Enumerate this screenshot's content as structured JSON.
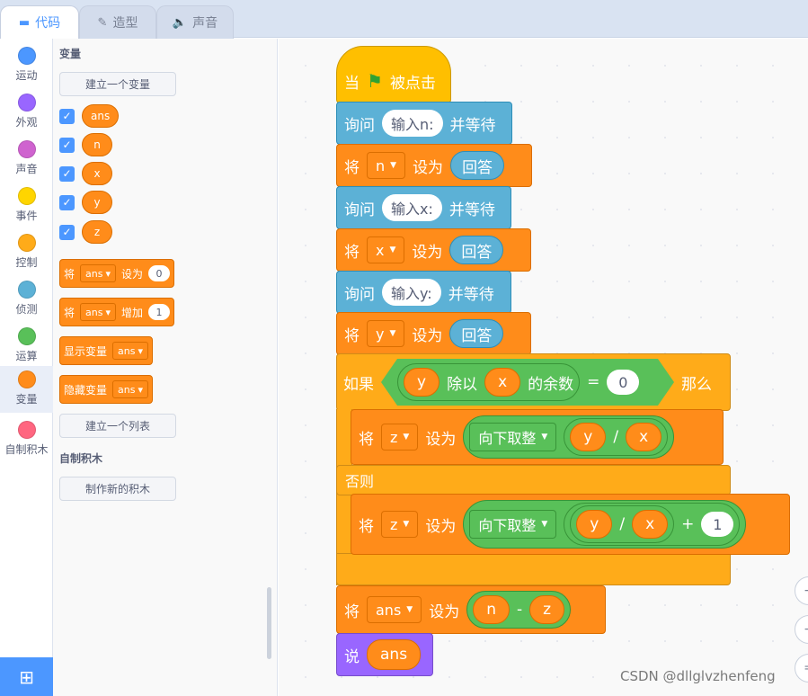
{
  "tabs": [
    {
      "label": "代码",
      "icon": "code-icon"
    },
    {
      "label": "造型",
      "icon": "brush-icon"
    },
    {
      "label": "声音",
      "icon": "speaker-icon"
    }
  ],
  "categories": [
    {
      "label": "运动",
      "color": "#4c97ff"
    },
    {
      "label": "外观",
      "color": "#9966ff"
    },
    {
      "label": "声音",
      "color": "#cf63cf"
    },
    {
      "label": "事件",
      "color": "#ffd500"
    },
    {
      "label": "控制",
      "color": "#ffab19"
    },
    {
      "label": "侦测",
      "color": "#5cb1d6"
    },
    {
      "label": "运算",
      "color": "#59c059"
    },
    {
      "label": "变量",
      "color": "#ff8c1a"
    },
    {
      "label": "自制积木",
      "color": "#ff6680"
    }
  ],
  "palette": {
    "section_variables": "变量",
    "make_variable": "建立一个变量",
    "variables": [
      "ans",
      "n",
      "x",
      "y",
      "z"
    ],
    "set_block": {
      "verb": "将",
      "var": "ans",
      "action": "设为",
      "value": "0"
    },
    "change_block": {
      "verb": "将",
      "var": "ans",
      "action": "增加",
      "value": "1"
    },
    "show_block": {
      "label": "显示变量",
      "var": "ans"
    },
    "hide_block": {
      "label": "隐藏变量",
      "var": "ans"
    },
    "make_list": "建立一个列表",
    "section_my_blocks": "自制积木",
    "make_block": "制作新的积木"
  },
  "script": {
    "hat": {
      "when": "当",
      "clicked": "被点击"
    },
    "ask_n": {
      "ask": "询问",
      "prompt": "输入n:",
      "wait": "并等待"
    },
    "set_n": {
      "verb": "将",
      "var": "n",
      "action": "设为",
      "value": "回答"
    },
    "ask_x": {
      "ask": "询问",
      "prompt": "输入x:",
      "wait": "并等待"
    },
    "set_x": {
      "verb": "将",
      "var": "x",
      "action": "设为",
      "value": "回答"
    },
    "ask_y": {
      "ask": "询问",
      "prompt": "输入y:",
      "wait": "并等待"
    },
    "set_y": {
      "verb": "将",
      "var": "y",
      "action": "设为",
      "value": "回答"
    },
    "if_block": {
      "if": "如果",
      "a": "y",
      "mod": "除以",
      "b": "x",
      "rem": "的余数",
      "eq": "=",
      "zero": "0",
      "then": "那么",
      "else": "否则"
    },
    "set_z1": {
      "verb": "将",
      "var": "z",
      "action": "设为",
      "func": "向下取整",
      "a": "y",
      "div": "/",
      "b": "x"
    },
    "set_z2": {
      "verb": "将",
      "var": "z",
      "action": "设为",
      "func": "向下取整",
      "a": "y",
      "div": "/",
      "b": "x",
      "plus": "+",
      "one": "1"
    },
    "set_ans": {
      "verb": "将",
      "var": "ans",
      "action": "设为",
      "a": "n",
      "minus": "-",
      "b": "z"
    },
    "say": {
      "say": "说",
      "var": "ans"
    }
  },
  "watermark": "CSDN @dllglvzhenfeng"
}
